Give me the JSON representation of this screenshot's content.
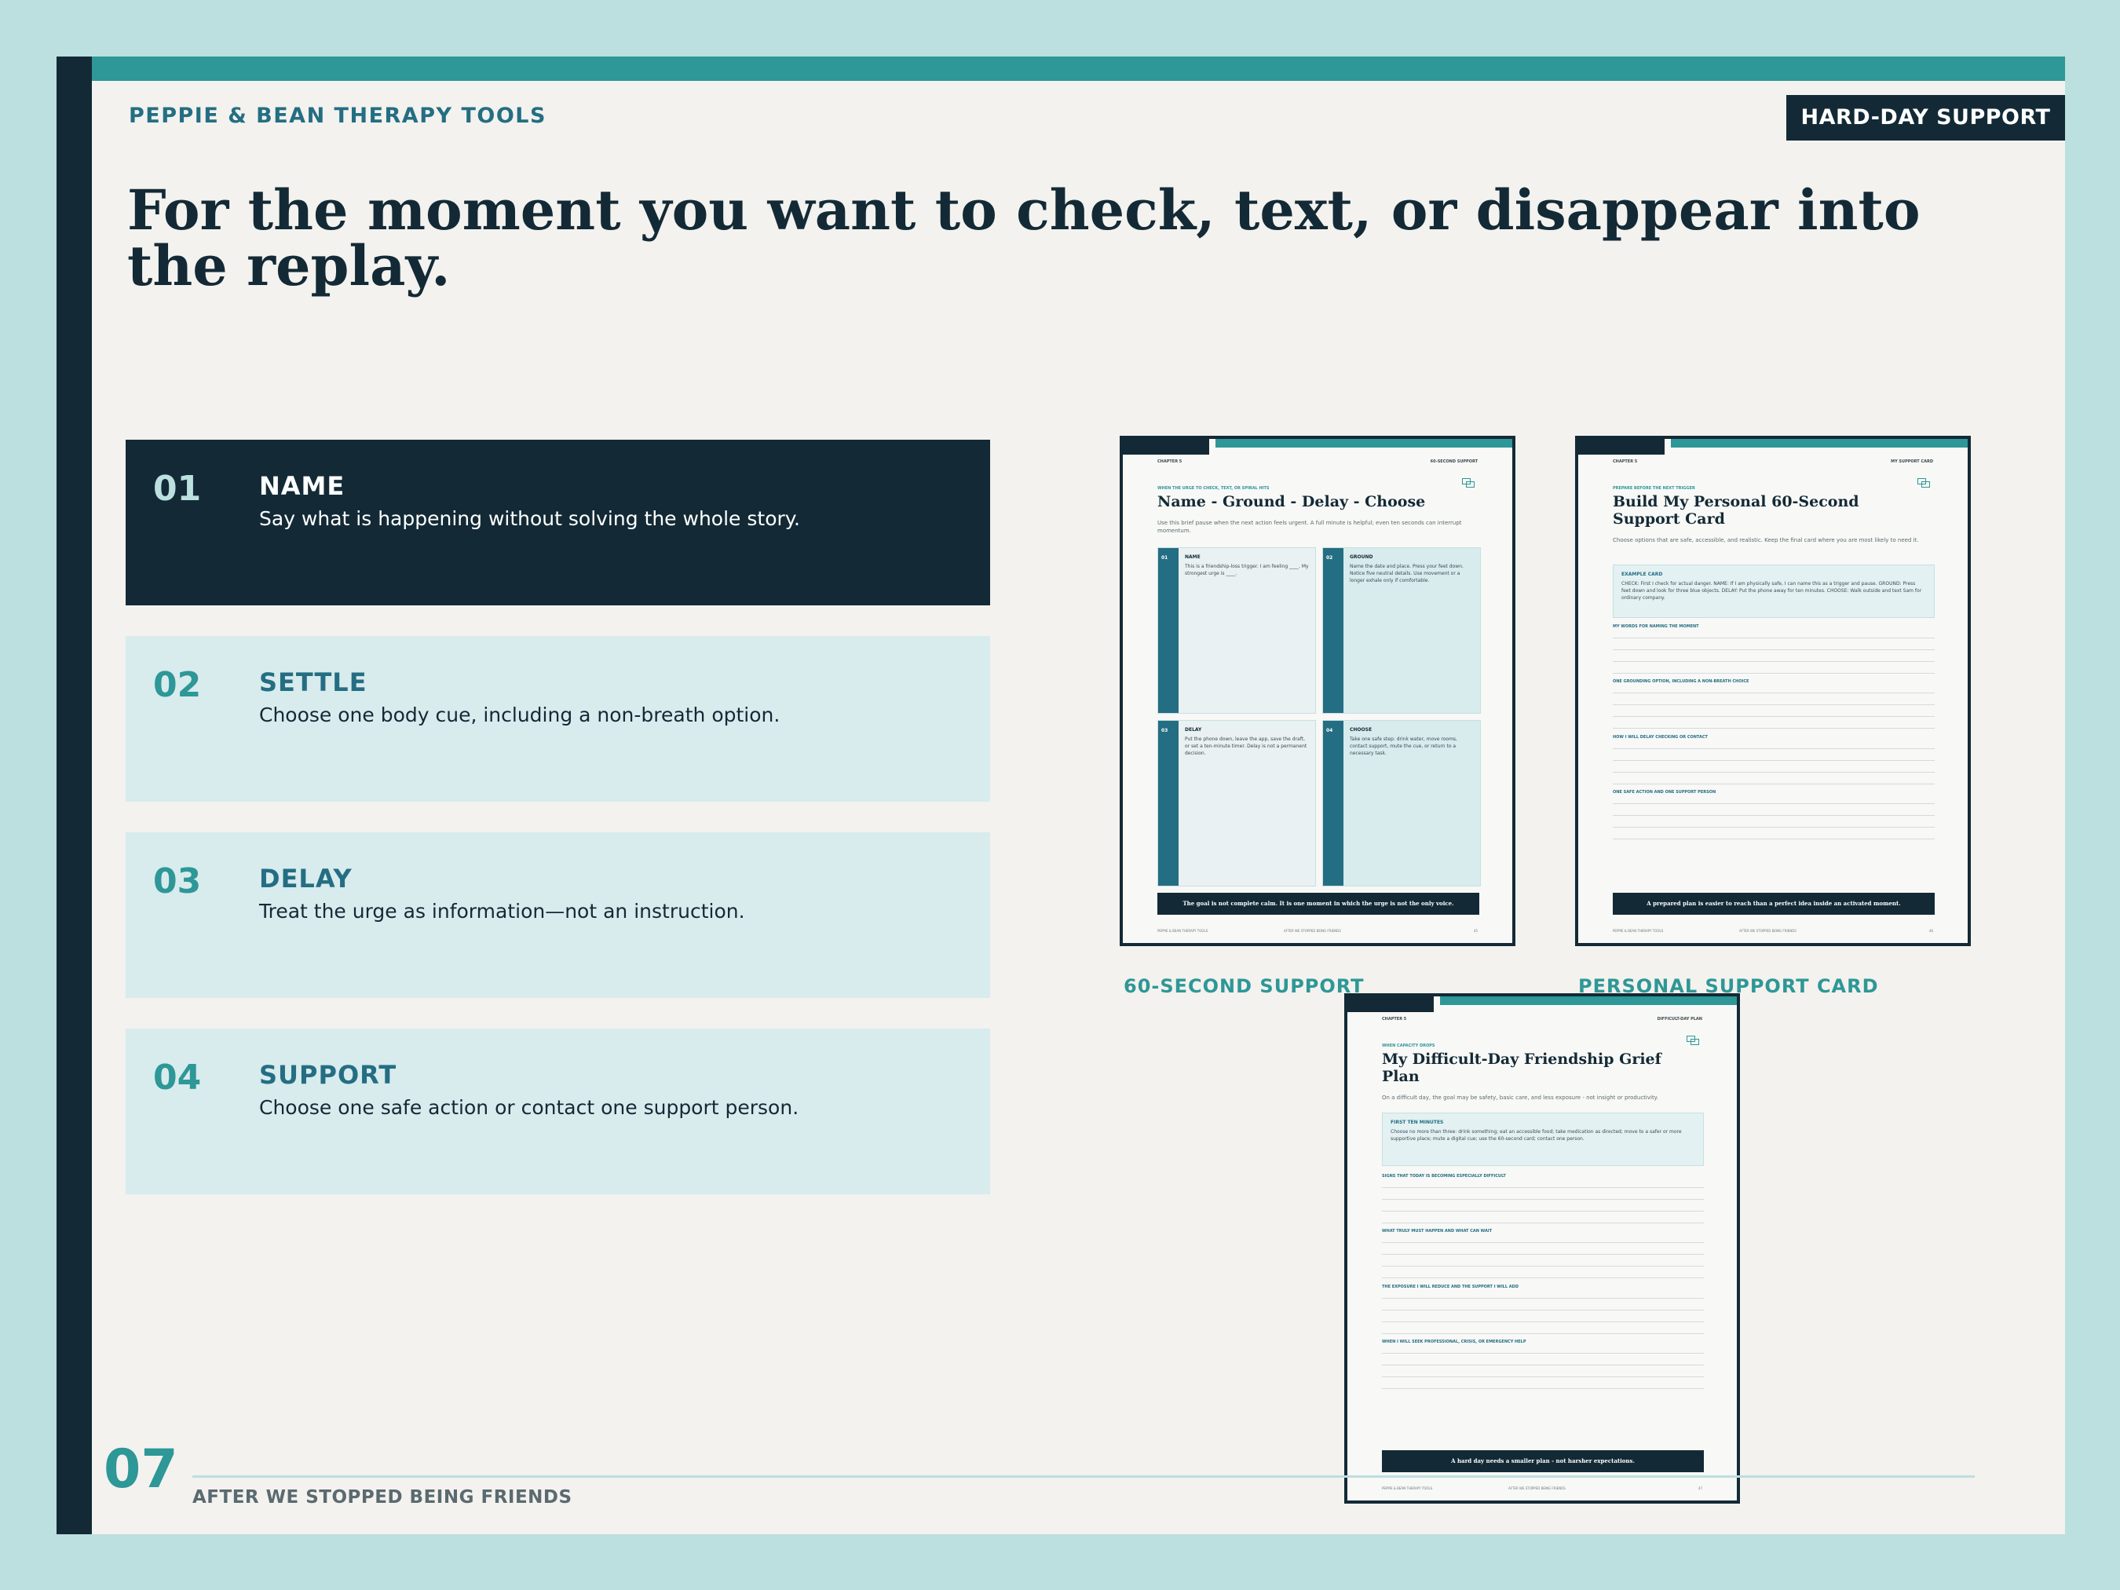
{
  "header": {
    "brand": "PEPPIE & BEAN THERAPY TOOLS",
    "badge": "HARD-DAY SUPPORT"
  },
  "headline": "For the moment you want to check, text, or disappear into the replay.",
  "steps": [
    {
      "num": "01",
      "title": "NAME",
      "desc": "Say what is happening without solving the whole story.",
      "active": true
    },
    {
      "num": "02",
      "title": "SETTLE",
      "desc": "Choose one body cue, including a non-breath option."
    },
    {
      "num": "03",
      "title": "DELAY",
      "desc": "Treat the urge as information—not an instruction."
    },
    {
      "num": "04",
      "title": "SUPPORT",
      "desc": "Choose one safe action or contact one support person."
    }
  ],
  "previews": {
    "support60": {
      "caption": "60-SECOND SUPPORT",
      "chapter": "CHAPTER 5",
      "tag": "60-SECOND SUPPORT",
      "kicker": "WHEN THE URGE TO CHECK, TEXT, OR SPIRAL HITS",
      "title": "Name - Ground - Delay - Choose",
      "subtitle": "Use this brief pause when the next action feels urgent. A full minute is helpful; even ten seconds can interrupt momentum.",
      "cards": [
        {
          "num": "01",
          "head": "NAME",
          "text": "This is a friendship-loss trigger. I am feeling ____. My strongest urge is ____."
        },
        {
          "num": "02",
          "head": "GROUND",
          "text": "Name the date and place. Press your feet down. Notice five neutral details. Use movement or a longer exhale only if comfortable."
        },
        {
          "num": "03",
          "head": "DELAY",
          "text": "Put the phone down, leave the app, save the draft, or set a ten-minute timer. Delay is not a permanent decision."
        },
        {
          "num": "04",
          "head": "CHOOSE",
          "text": "Take one safe step: drink water, move rooms, contact support, mute the cue, or return to a necessary task."
        }
      ],
      "footer": "The goal is not complete calm. It is one moment in which the urge is not the only voice.",
      "foot_left": "PEPPIE & BEAN THERAPY TOOLS",
      "foot_mid": "AFTER WE STOPPED BEING FRIENDS",
      "foot_right": "45"
    },
    "personal": {
      "caption": "PERSONAL SUPPORT CARD",
      "chapter": "CHAPTER 5",
      "tag": "MY SUPPORT CARD",
      "kicker": "PREPARE BEFORE THE NEXT TRIGGER",
      "title": "Build My Personal 60-Second Support Card",
      "subtitle": "Choose options that are safe, accessible, and realistic. Keep the final card where you are most likely to need it.",
      "box_head": "EXAMPLE CARD",
      "box_text": "CHECK: First I check for actual danger. NAME: If I am physically safe, I can name this as a trigger and pause. GROUND: Press feet down and look for three blue objects. DELAY: Put the phone away for ten minutes. CHOOSE: Walk outside and text Sam for ordinary company.",
      "sections": [
        "MY WORDS FOR NAMING THE MOMENT",
        "ONE GROUNDING OPTION, INCLUDING A NON-BREATH CHOICE",
        "HOW I WILL DELAY CHECKING OR CONTACT",
        "ONE SAFE ACTION AND ONE SUPPORT PERSON"
      ],
      "footer": "A prepared plan is easier to reach than a perfect idea inside an activated moment.",
      "foot_left": "PEPPIE & BEAN THERAPY TOOLS",
      "foot_mid": "AFTER WE STOPPED BEING FRIENDS",
      "foot_right": "46"
    },
    "difficult": {
      "chapter": "CHAPTER 5",
      "tag": "DIFFICULT-DAY PLAN",
      "kicker": "WHEN CAPACITY DROPS",
      "title": "My Difficult-Day Friendship Grief Plan",
      "subtitle": "On a difficult day, the goal may be safety, basic care, and less exposure - not insight or productivity.",
      "box_head": "FIRST TEN MINUTES",
      "box_text": "Choose no more than three: drink something; eat an accessible food; take medication as directed; move to a safer or more supportive place; mute a digital cue; use the 60-second card; contact one person.",
      "sections": [
        "SIGNS THAT TODAY IS BECOMING ESPECIALLY DIFFICULT",
        "WHAT TRULY MUST HAPPEN AND WHAT CAN WAIT",
        "THE EXPOSURE I WILL REDUCE AND THE SUPPORT I WILL ADD",
        "WHEN I WILL SEEK PROFESSIONAL, CRISIS, OR EMERGENCY HELP"
      ],
      "footer": "A hard day needs a smaller plan - not harsher expectations.",
      "foot_left": "PEPPIE & BEAN THERAPY TOOLS",
      "foot_mid": "AFTER WE STOPPED BEING FRIENDS",
      "foot_right": "47"
    }
  },
  "footer": {
    "page_number": "07",
    "book_title": "AFTER WE STOPPED BEING FRIENDS"
  },
  "colors": {
    "navy": "#132a36",
    "teal": "#2e9797",
    "deep_teal": "#246e83",
    "pale_teal": "#d8ebed",
    "page_bg": "#f3f2ee",
    "outer_bg": "#bcdfdf"
  }
}
